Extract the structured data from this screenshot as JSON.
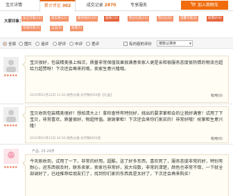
{
  "tabs": [
    {
      "label": "宝贝详情",
      "count": ""
    },
    {
      "label": "累计评论",
      "count": "302"
    },
    {
      "label": "成交记录",
      "count": "2870"
    },
    {
      "label": "专享服务",
      "count": ""
    }
  ],
  "cart_label": "加入购物车",
  "tags_title": "大家印象：",
  "tags_row1": [
    "安全可靠(52)",
    "挺实惠(12)",
    "服务很好(29)",
    "画质(12)",
    "性价比高(11)",
    "性价比(9)",
    "温馨可靠(8)",
    "质量好(8)"
  ],
  "tags_row2": [
    "毛绒可爱(5)",
    "正品(6)",
    "质量(5)"
  ],
  "filter": {
    "all": "全部",
    "with_pic": "图片",
    "follow": "追评",
    "good": "好评",
    "mid": "中评",
    "bad": "差评",
    "has_content": "有内容的评价",
    "sort": "按默认排序"
  },
  "reviews": [
    {
      "stars": "★★★★★",
      "text": "宝贝很好，包装精美很上档次，质量非常保值效果很满意卖家人更是亲和很服务态度很热情的物流也超给力超赞呀！下次还会再来的哦，卖家生意兴隆哦。",
      "meta": "2015年01月22日 11:20    颜色分类:光学数码50倍【礼盒】",
      "useful": "有用(0)"
    },
    {
      "stars": "★★★★★",
      "text": "宝贝收到包装精美很好！想拍清大上！拿检查所有特别好，挑出的要求掌柜会的让我好满意！试用了下宝贝，非常喜欢，质量很好，物超所值。谢谢掌柜！下次还会来你们家买的！非常好哦！祝掌柜生意兴隆！",
      "meta": "2015年01月21日 20:56    颜色分类:光学数码50倍",
      "useful": "有用(0)"
    },
    {
      "stars": "★★★★★",
      "text": "今天刚收到，试用了一下，非常的好用，超酷，送了好多东西，喜欢死了，服务态度非常的好，特别有耐心，运东西很及时，联系卖家，卖家也非常好，放大倍数，非常的清楚，颜色也非常不错，一下就全部调好了，已经推荐给朋友们了，找到你们家的东西真是太好了，下次还会再来购买！",
      "meta": "颜色分类:光学数码50倍",
      "extra": "产品: 25-29岁",
      "useful": ""
    }
  ]
}
